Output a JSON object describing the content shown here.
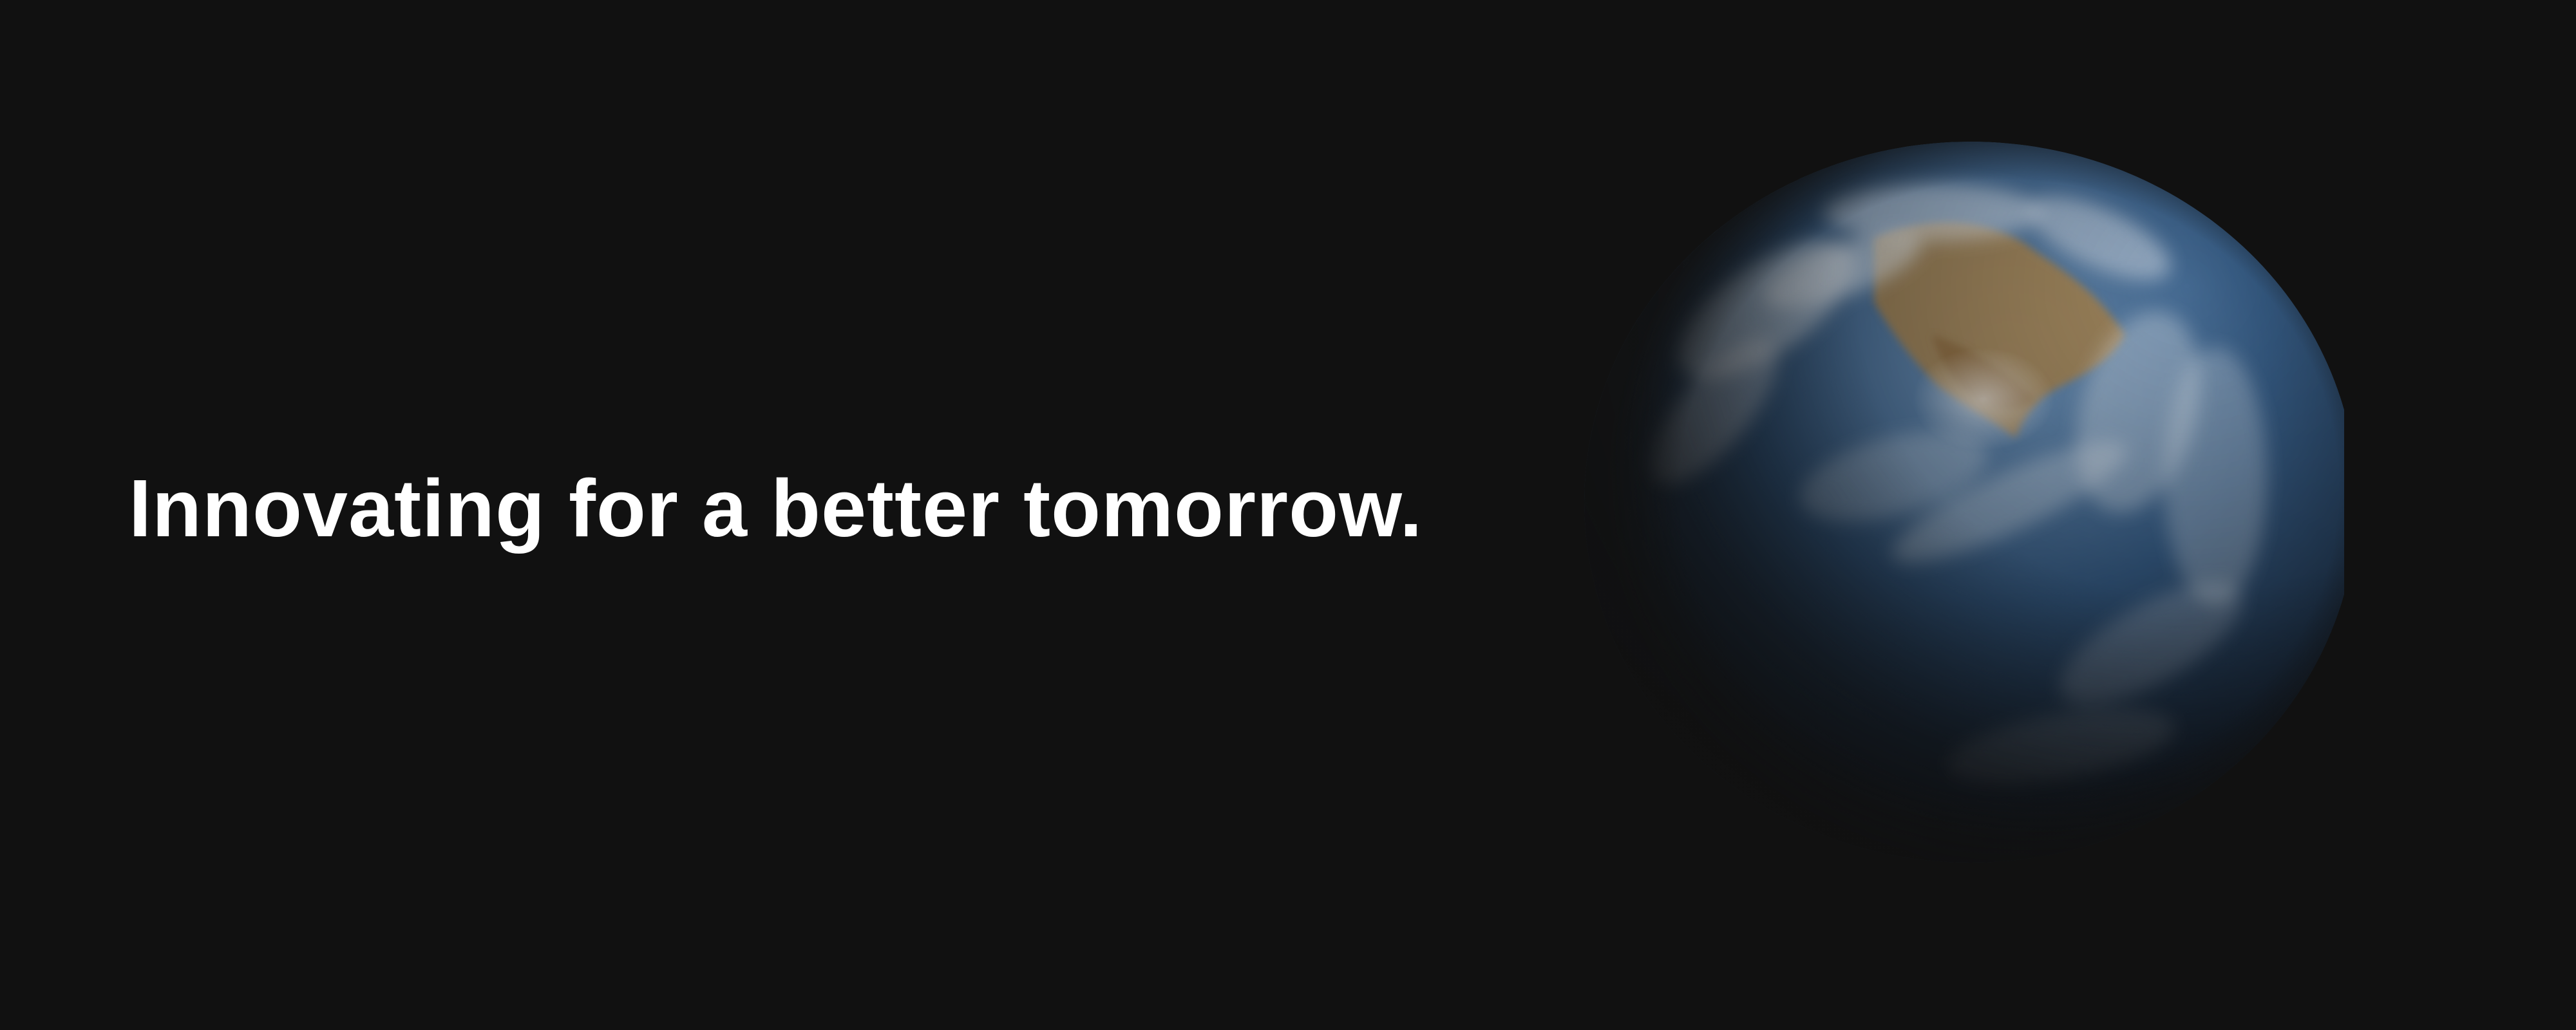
{
  "hero": {
    "headline": "Innovating for a better tomorrow."
  },
  "colors": {
    "background": "#111111",
    "headline_text": "#ffffff",
    "ocean": "#3a5f8a",
    "land": "#b08a55",
    "clouds": "#e6ecf2"
  },
  "icons": {
    "earth_image": "earth-globe-icon"
  }
}
